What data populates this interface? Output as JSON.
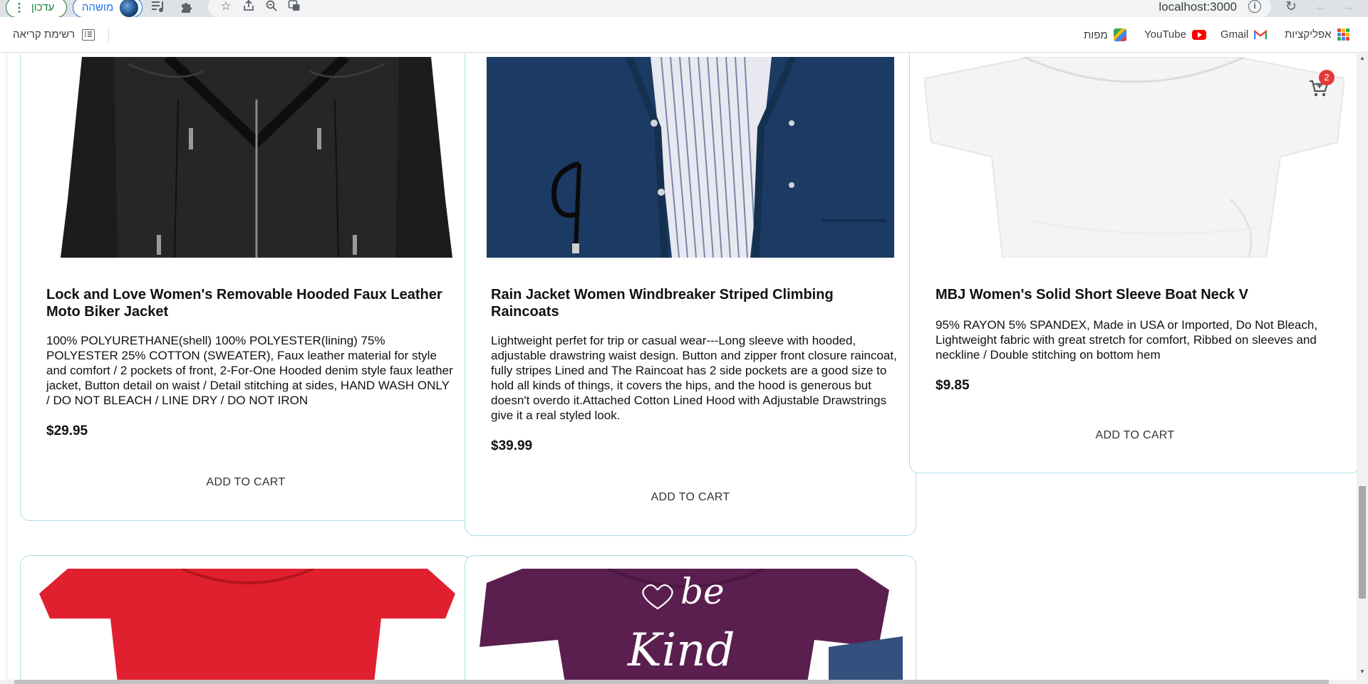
{
  "browser": {
    "update_label": "עדכון",
    "profile_label": "מושהה",
    "url": "localhost:3000",
    "info_glyph": "i"
  },
  "bookmarks": {
    "apps": "אפליקציות",
    "gmail": "Gmail",
    "youtube": "YouTube",
    "maps": "מפות",
    "reading_list": "רשימת קריאה"
  },
  "cart": {
    "count": "2"
  },
  "products": [
    {
      "title": "Lock and Love Women's Removable Hooded Faux Leather Moto Biker Jacket",
      "description": "100% POLYURETHANE(shell) 100% POLYESTER(lining) 75% POLYESTER 25% COTTON (SWEATER), Faux leather material for style and comfort / 2 pockets of front, 2-For-One Hooded denim style faux leather jacket, Button detail on waist / Detail stitching at sides, HAND WASH ONLY / DO NOT BLEACH / LINE DRY / DO NOT IRON",
      "price": "$29.95",
      "add_to_cart": "ADD TO CART"
    },
    {
      "title": "Rain Jacket Women Windbreaker Striped Climbing Raincoats",
      "description": "Lightweight perfet for trip or casual wear---Long sleeve with hooded, adjustable drawstring waist design. Button and zipper front closure raincoat, fully stripes Lined and The Raincoat has 2 side pockets are a good size to hold all kinds of things, it covers the hips, and the hood is generous but doesn't overdo it.Attached Cotton Lined Hood with Adjustable Drawstrings give it a real styled look.",
      "price": "$39.99",
      "add_to_cart": "ADD TO CART"
    },
    {
      "title": "MBJ Women's Solid Short Sleeve Boat Neck V",
      "description": "95% RAYON 5% SPANDEX, Made in USA or Imported, Do Not Bleach, Lightweight fabric with great stretch for comfort, Ribbed on sleeves and neckline / Double stitching on bottom hem",
      "price": "$9.85",
      "add_to_cart": "ADD TO CART"
    }
  ],
  "tshirt_print": {
    "line1": "be",
    "line2": "Kind"
  },
  "colors": {
    "card_border": "#a9dde9",
    "badge": "#e53935",
    "leather": "#1c1c1c",
    "navy": "#1b3a64",
    "red_shirt": "#e0202e",
    "purple_shirt": "#5a1f4f"
  }
}
